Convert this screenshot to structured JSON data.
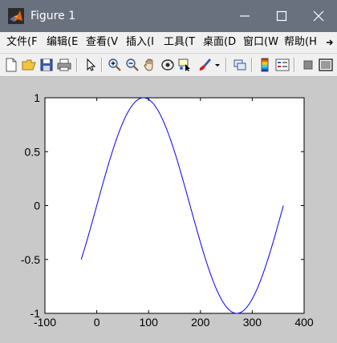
{
  "window": {
    "title": "Figure 1",
    "controls": {
      "minimize_icon": "minimize-icon",
      "maximize_icon": "maximize-icon",
      "close_icon": "close-icon"
    }
  },
  "menu": {
    "items": [
      {
        "label": "文件(F"
      },
      {
        "label": "编辑(E"
      },
      {
        "label": "查看(V"
      },
      {
        "label": "插入(I"
      },
      {
        "label": "工具(T"
      },
      {
        "label": "桌面(D"
      },
      {
        "label": "窗口(W"
      },
      {
        "label": "帮助(H"
      }
    ],
    "overflow_icon": "chevron-right-icon"
  },
  "toolbar": {
    "buttons": [
      "new-figure-icon",
      "open-file-icon",
      "save-icon",
      "print-icon",
      "pointer-icon",
      "zoom-in-icon",
      "zoom-out-icon",
      "pan-hand-icon",
      "rotate-3d-icon",
      "data-cursor-icon",
      "brush-icon",
      "link-icon",
      "colorbar-icon",
      "legend-icon",
      "hide-plot-tools-icon",
      "show-plot-tools-icon"
    ]
  },
  "colors": {
    "titlebar": "#69717f",
    "figure_background": "#c9c9c9",
    "axes_background": "#ffffff",
    "line": "#0000ff"
  },
  "chart_data": {
    "type": "line",
    "title": "",
    "xlabel": "",
    "ylabel": "",
    "xlim": [
      -100,
      400
    ],
    "ylim": [
      -1,
      1
    ],
    "xticks": [
      -100,
      0,
      100,
      200,
      300,
      400
    ],
    "yticks": [
      -1,
      -0.5,
      0,
      0.5,
      1
    ],
    "xtick_labels": [
      "-100",
      "0",
      "100",
      "200",
      "300",
      "400"
    ],
    "ytick_labels": [
      "-1",
      "-0.5",
      "0",
      "0.5",
      "1"
    ],
    "grid": false,
    "series": [
      {
        "function": "sin(x in degrees)",
        "x_start": -30,
        "x_end": 360,
        "color": "#0000ff"
      }
    ]
  }
}
